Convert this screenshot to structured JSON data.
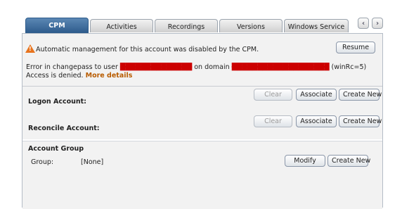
{
  "tabs": [
    {
      "label": "CPM",
      "active": true
    },
    {
      "label": "Activities",
      "active": false
    },
    {
      "label": "Recordings",
      "active": false
    },
    {
      "label": "Versions",
      "active": false
    },
    {
      "label": "Windows Service",
      "active": false
    }
  ],
  "nav": {
    "prev": "‹",
    "next": "›"
  },
  "alert": {
    "message": "Automatic management for this account was disabled by the CPM.",
    "resume_label": "Resume",
    "error_prefix": "Error in changepass to user",
    "redacted_user": "██████████████",
    "on_domain": "on domain",
    "redacted_domain": "███████████████████",
    "error_suffix": "(winRc=5) Access is denied.",
    "more_details": "More details"
  },
  "logon": {
    "title": "Logon Account:",
    "clear": "Clear",
    "associate": "Associate",
    "create_new": "Create New"
  },
  "reconcile": {
    "title": "Reconcile Account:",
    "clear": "Clear",
    "associate": "Associate",
    "create_new": "Create New"
  },
  "group": {
    "title": "Account Group",
    "field_label": "Group:",
    "field_value": "[None]",
    "modify": "Modify",
    "create_new": "Create New"
  },
  "colors": {
    "active_tab": "#2d5b8b",
    "warning": "#e8741e",
    "link": "#b85c00",
    "redaction": "#cc0000"
  }
}
